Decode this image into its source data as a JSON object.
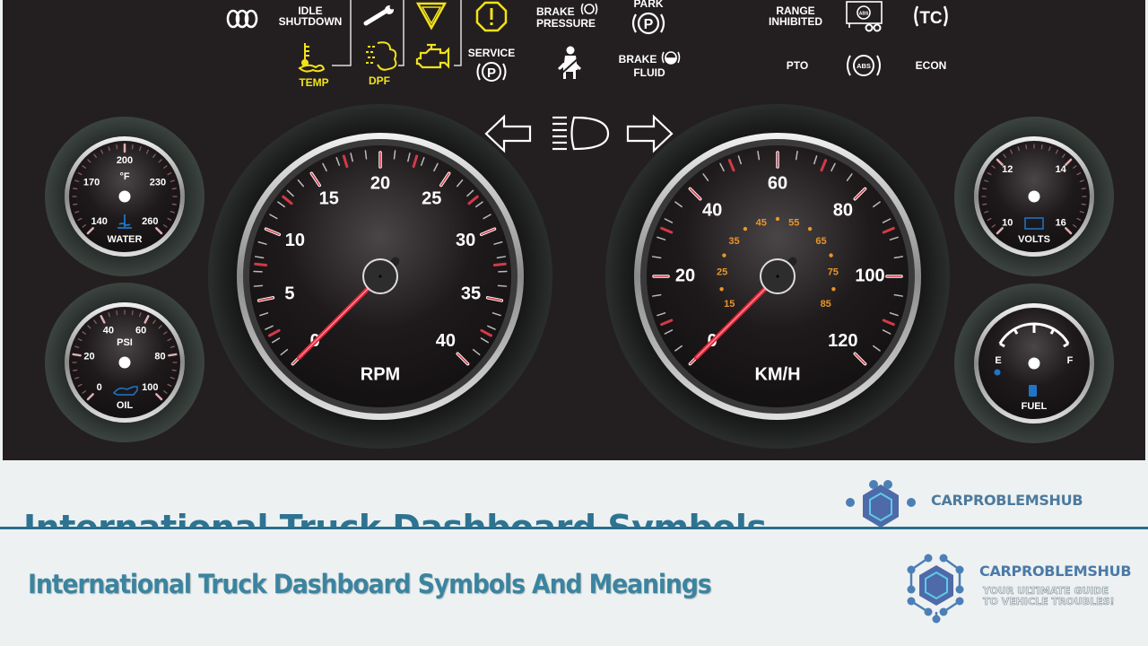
{
  "indicators": {
    "glow_plug": {
      "icon": "glow-plug-icon"
    },
    "idle_shutdown": {
      "label_1": "IDLE",
      "label_2": "SHUTDOWN"
    },
    "wrench": {
      "icon": "wrench-icon"
    },
    "warning_triangle": {
      "icon": "warning-triangle-icon"
    },
    "stop_octagon": {
      "icon": "stop-octagon-icon"
    },
    "brake_pressure": {
      "label_1": "BRAKE",
      "label_2": "PRESSURE",
      "icon": "brake-warning-icon"
    },
    "park": {
      "label": "PARK",
      "icon": "park-brake-icon"
    },
    "range_inhibited": {
      "label_1": "RANGE",
      "label_2": "INHIBITED"
    },
    "trailer_abs": {
      "icon": "trailer-abs-icon",
      "badge": "ABS"
    },
    "traction_control": {
      "label": "TC"
    },
    "temp": {
      "label": "TEMP",
      "icon": "coolant-temp-icon"
    },
    "dpf": {
      "label": "DPF",
      "icon": "dpf-icon"
    },
    "check_engine": {
      "icon": "check-engine-icon"
    },
    "service_park": {
      "label": "SERVICE",
      "icon": "service-park-icon"
    },
    "seatbelt": {
      "icon": "seatbelt-icon"
    },
    "brake_fluid": {
      "label_1": "BRAKE",
      "label_2": "FLUID",
      "icon": "brake-fluid-icon"
    },
    "pto": {
      "label": "PTO"
    },
    "abs": {
      "label": "ABS"
    },
    "econ": {
      "label": "ECON"
    },
    "turn_left": {
      "icon": "turn-signal-left-icon"
    },
    "high_beam": {
      "icon": "high-beam-icon"
    },
    "turn_right": {
      "icon": "turn-signal-right-icon"
    }
  },
  "colors": {
    "panel": "#231f20",
    "indicator_white": "#ffffff",
    "indicator_amber": "#f2e21b",
    "needle_red": "#e2283a",
    "tick_red": "#d23a48",
    "inner_scale": "#e8952b",
    "gauge_blue": "#1f76c8",
    "caption_teal": "#3b84a0",
    "brand_blue": "#4a7aa8",
    "page_bg": "#edf1f1"
  },
  "gauges": {
    "tachometer": {
      "unit": "RPM",
      "min": 0,
      "max": 40,
      "labels": [
        "0",
        "5",
        "10",
        "15",
        "20",
        "25",
        "30",
        "35",
        "40"
      ],
      "needle_value": 0
    },
    "speedometer": {
      "unit": "KM/H",
      "min": 0,
      "max": 120,
      "labels": [
        "0",
        "20",
        "40",
        "60",
        "80",
        "100",
        "120"
      ],
      "needle_value": 0,
      "inner_labels": [
        "15",
        "25",
        "35",
        "45",
        "55",
        "65",
        "75",
        "85"
      ]
    },
    "water_temp": {
      "unit": "°F",
      "label": "WATER",
      "labels": [
        "140",
        "170",
        "200",
        "230",
        "260"
      ]
    },
    "oil_pressure": {
      "unit": "PSI",
      "label": "OIL",
      "labels": [
        "0",
        "20",
        "40",
        "60",
        "80",
        "100"
      ]
    },
    "volts": {
      "label": "VOLTS",
      "labels": [
        "10",
        "12",
        "14",
        "16"
      ]
    },
    "fuel": {
      "label": "FUEL",
      "empty": "E",
      "full": "F"
    }
  },
  "page": {
    "ghost_title": "International Truck Dashboard Symbols",
    "caption": "International Truck Dashboard Symbols And Meanings",
    "brand": "CARPROBLEMSHUB",
    "tagline_1": "YOUR ULTIMATE GUIDE",
    "tagline_2": "TO VEHICLE TROUBLES!"
  }
}
